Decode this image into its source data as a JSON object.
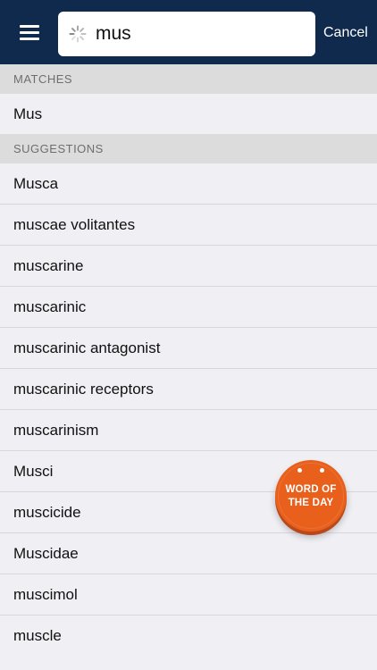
{
  "header": {
    "search_value": "mus",
    "cancel_label": "Cancel"
  },
  "sections": {
    "matches_title": "MATCHES",
    "suggestions_title": "SUGGESTIONS"
  },
  "matches": [
    "Mus"
  ],
  "suggestions": [
    "Musca",
    "muscae volitantes",
    "muscarine",
    "muscarinic",
    "muscarinic antagonist",
    "muscarinic receptors",
    "muscarinism",
    "Musci",
    "muscicide",
    "Muscidae",
    "muscimol",
    "muscle"
  ],
  "word_of_the_day": {
    "line1": "WORD OF",
    "line2": "THE DAY"
  },
  "icons": {
    "menu": "hamburger-menu-icon",
    "loading": "loading-spinner-icon"
  },
  "colors": {
    "header_bg": "#0f2a4d",
    "badge": "#e8601c",
    "section_bg": "#dcdcdc",
    "list_bg": "#efeff4"
  }
}
